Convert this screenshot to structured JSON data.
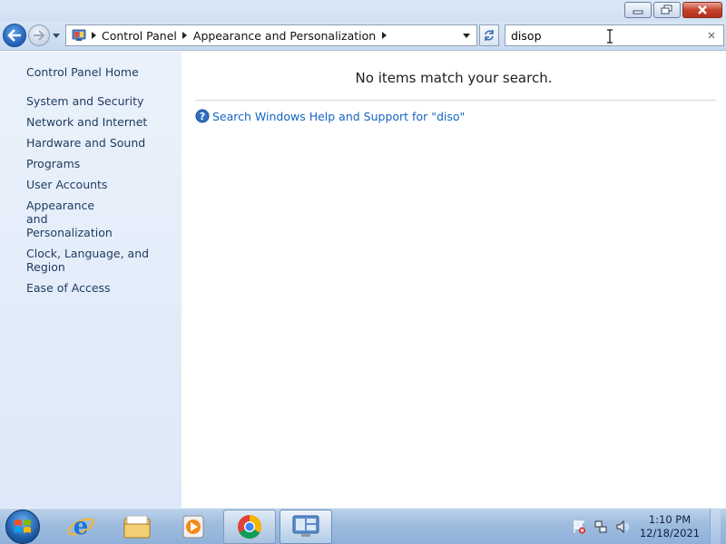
{
  "window": {
    "buttons": {
      "minimize": "minimize",
      "restore": "restore",
      "close": "close"
    }
  },
  "navbar": {
    "breadcrumbs": [
      "Control Panel",
      "Appearance and Personalization"
    ],
    "search": {
      "value": "disop",
      "placeholder": ""
    }
  },
  "sidebar": {
    "home": "Control Panel Home",
    "items": [
      "System and Security",
      "Network and Internet",
      "Hardware and Sound",
      "Programs",
      "User Accounts",
      "Appearance and Personalization",
      "Clock, Language, and Region",
      "Ease of Access"
    ]
  },
  "main": {
    "message": "No items match your search.",
    "help_link": "Search Windows Help and Support for \"diso\""
  },
  "taskbar": {
    "pinned": [
      "internet-explorer",
      "windows-explorer",
      "media-player",
      "chrome",
      "control-panel"
    ],
    "clock": {
      "time": "1:10 PM",
      "date": "12/18/2021"
    }
  },
  "colors": {
    "link": "#1565c0",
    "sidebar_bg": "#e3edf9",
    "taskbar": "#9ebcdf"
  }
}
